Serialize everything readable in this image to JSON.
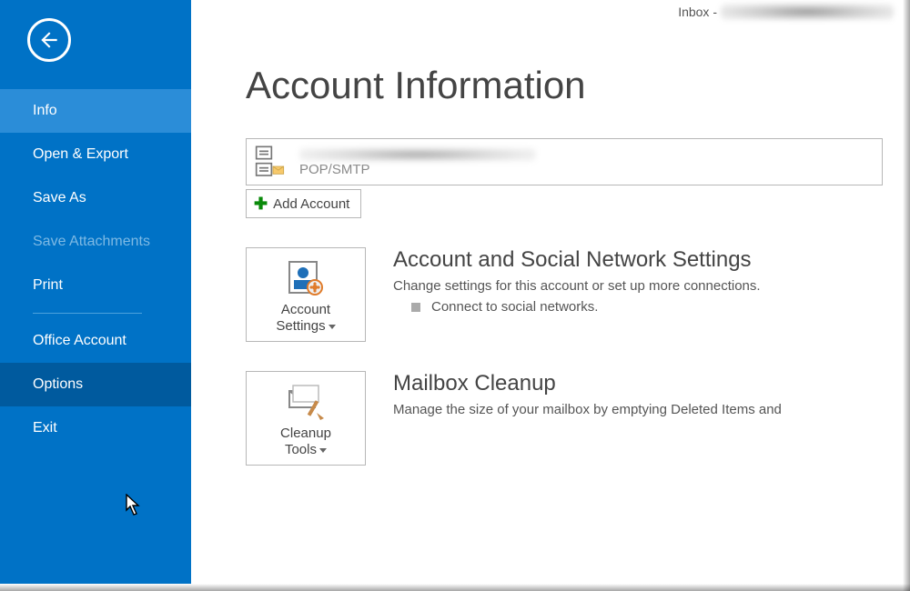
{
  "titlebar": {
    "folder": "Inbox -"
  },
  "sidebar": {
    "items": [
      {
        "label": "Info",
        "state": "selected"
      },
      {
        "label": "Open & Export"
      },
      {
        "label": "Save As"
      },
      {
        "label": "Save Attachments",
        "state": "disabled"
      },
      {
        "label": "Print"
      },
      {
        "sep": true
      },
      {
        "label": "Office Account"
      },
      {
        "label": "Options",
        "state": "hover"
      },
      {
        "label": "Exit"
      }
    ]
  },
  "page": {
    "title": "Account Information",
    "account": {
      "type": "POP/SMTP"
    },
    "add_account_label": "Add Account",
    "sections": [
      {
        "button_label_line1": "Account",
        "button_label_line2": "Settings",
        "heading": "Account and Social Network Settings",
        "desc": "Change settings for this account or set up more connections.",
        "bullet": "Connect to social networks."
      },
      {
        "button_label_line1": "Cleanup",
        "button_label_line2": "Tools",
        "heading": "Mailbox Cleanup",
        "desc": "Manage the size of your mailbox by emptying Deleted Items and"
      }
    ]
  }
}
